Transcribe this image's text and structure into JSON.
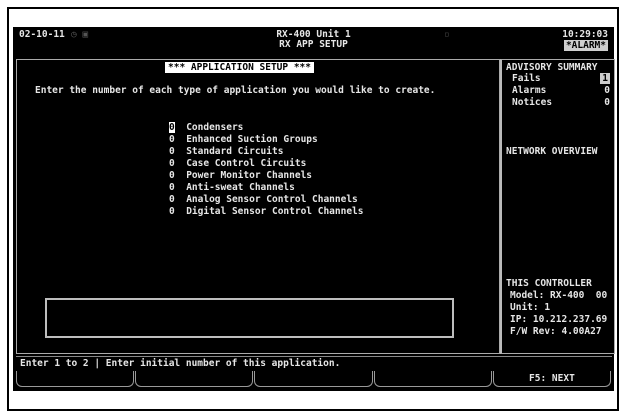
{
  "header": {
    "date": "02-10-11",
    "title_line1": "RX-400 Unit 1",
    "title_line2": "RX APP SETUP",
    "time": "10:29:03",
    "alarm_badge": "*ALARM*"
  },
  "main": {
    "heading": "*** APPLICATION SETUP ***",
    "instruction": "Enter the number of each type of application you would like to create.",
    "applications": [
      {
        "count": "0",
        "label": "Condensers"
      },
      {
        "count": "0",
        "label": "Enhanced Suction Groups"
      },
      {
        "count": "0",
        "label": "Standard Circuits"
      },
      {
        "count": "0",
        "label": "Case Control Circuits"
      },
      {
        "count": "0",
        "label": "Power Monitor Channels"
      },
      {
        "count": "0",
        "label": "Anti-sweat Channels"
      },
      {
        "count": "0",
        "label": "Analog Sensor Control Channels"
      },
      {
        "count": "0",
        "label": "Digital Sensor Control Channels"
      }
    ]
  },
  "advisory": {
    "title": "ADVISORY SUMMARY",
    "fails_label": "Fails",
    "fails_value": "1",
    "alarms_label": "Alarms",
    "alarms_value": "0",
    "notices_label": "Notices",
    "notices_value": "0"
  },
  "network": {
    "title": "NETWORK OVERVIEW"
  },
  "controller": {
    "title": "THIS CONTROLLER",
    "model": "Model: RX-400  00",
    "unit": "Unit: 1",
    "ip": "IP: 10.212.237.69",
    "fw": "F/W Rev: 4.00A27"
  },
  "status": "Enter 1 to 2 | Enter initial number of this application.",
  "fkeys": [
    "",
    "",
    "",
    "",
    "F5: NEXT"
  ]
}
